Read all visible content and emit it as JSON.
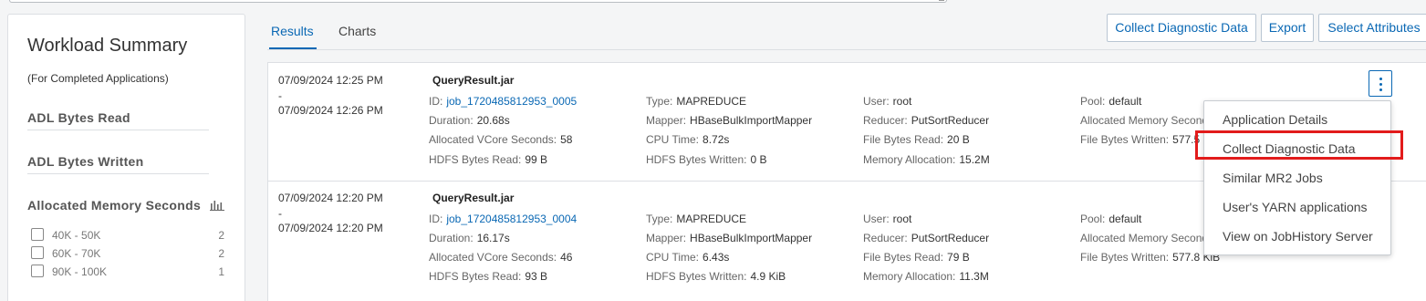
{
  "workload_summary": {
    "title": "Workload Summary",
    "subtitle": "(For Completed Applications)",
    "facets": [
      {
        "label": "ADL Bytes Read"
      },
      {
        "label": "ADL Bytes Written"
      },
      {
        "label": "Allocated Memory Seconds"
      }
    ],
    "buckets": [
      {
        "label": "40K - 50K",
        "count": "2"
      },
      {
        "label": "60K - 70K",
        "count": "2"
      },
      {
        "label": "90K - 100K",
        "count": "1"
      }
    ]
  },
  "tabs": [
    {
      "label": "Results",
      "active": true
    },
    {
      "label": "Charts",
      "active": false
    }
  ],
  "toolbar": {
    "collect_label": "Collect Diagnostic Data",
    "export_label": "Export",
    "select_label": "Select Attributes"
  },
  "rows": [
    {
      "start": "07/09/2024 12:25 PM",
      "dash": "-",
      "end": "07/09/2024 12:26 PM",
      "jar": "QueryResult.jar",
      "id": {
        "k": "ID:",
        "v": "job_1720485812953_0005"
      },
      "duration": {
        "k": "Duration:",
        "v": "20.68s"
      },
      "vcore": {
        "k": "Allocated VCore Seconds:",
        "v": "58"
      },
      "hdfs_read": {
        "k": "HDFS Bytes Read:",
        "v": "99 B"
      },
      "type": {
        "k": "Type:",
        "v": "MAPREDUCE"
      },
      "mapper": {
        "k": "Mapper:",
        "v": "HBaseBulkImportMapper"
      },
      "cpu": {
        "k": "CPU Time:",
        "v": "8.72s"
      },
      "hdfs_written": {
        "k": "HDFS Bytes Written:",
        "v": "0 B"
      },
      "user": {
        "k": "User:",
        "v": "root"
      },
      "reducer": {
        "k": "Reducer:",
        "v": "PutSortReducer"
      },
      "file_read": {
        "k": "File Bytes Read:",
        "v": "20 B"
      },
      "memory": {
        "k": "Memory Allocation:",
        "v": "15.2M"
      },
      "pool": {
        "k": "Pool:",
        "v": "default"
      },
      "alloc_mem": {
        "k": "Allocated Memory Seconds",
        "v": ""
      },
      "file_written": {
        "k": "File Bytes Written:",
        "v": "577.5"
      }
    },
    {
      "start": "07/09/2024 12:20 PM",
      "dash": "-",
      "end": "07/09/2024 12:20 PM",
      "jar": "QueryResult.jar",
      "id": {
        "k": "ID:",
        "v": "job_1720485812953_0004"
      },
      "duration": {
        "k": "Duration:",
        "v": "16.17s"
      },
      "vcore": {
        "k": "Allocated VCore Seconds:",
        "v": "46"
      },
      "hdfs_read": {
        "k": "HDFS Bytes Read:",
        "v": "93 B"
      },
      "type": {
        "k": "Type:",
        "v": "MAPREDUCE"
      },
      "mapper": {
        "k": "Mapper:",
        "v": "HBaseBulkImportMapper"
      },
      "cpu": {
        "k": "CPU Time:",
        "v": "6.43s"
      },
      "hdfs_written": {
        "k": "HDFS Bytes Written:",
        "v": "4.9 KiB"
      },
      "user": {
        "k": "User:",
        "v": "root"
      },
      "reducer": {
        "k": "Reducer:",
        "v": "PutSortReducer"
      },
      "file_read": {
        "k": "File Bytes Read:",
        "v": "79 B"
      },
      "memory": {
        "k": "Memory Allocation:",
        "v": "11.3M"
      },
      "pool": {
        "k": "Pool:",
        "v": "default"
      },
      "alloc_mem": {
        "k": "Allocated Memory Seconds",
        "v": ""
      },
      "file_written": {
        "k": "File Bytes Written:",
        "v": "577.8 KiB"
      }
    }
  ],
  "menu": {
    "items": [
      "Application Details",
      "Collect Diagnostic Data",
      "Similar MR2 Jobs",
      "User's YARN applications",
      "View on JobHistory Server"
    ],
    "highlighted": "Collect Diagnostic Data"
  },
  "colors": {
    "accent": "#0a68b4",
    "highlight": "#e21b1b"
  }
}
